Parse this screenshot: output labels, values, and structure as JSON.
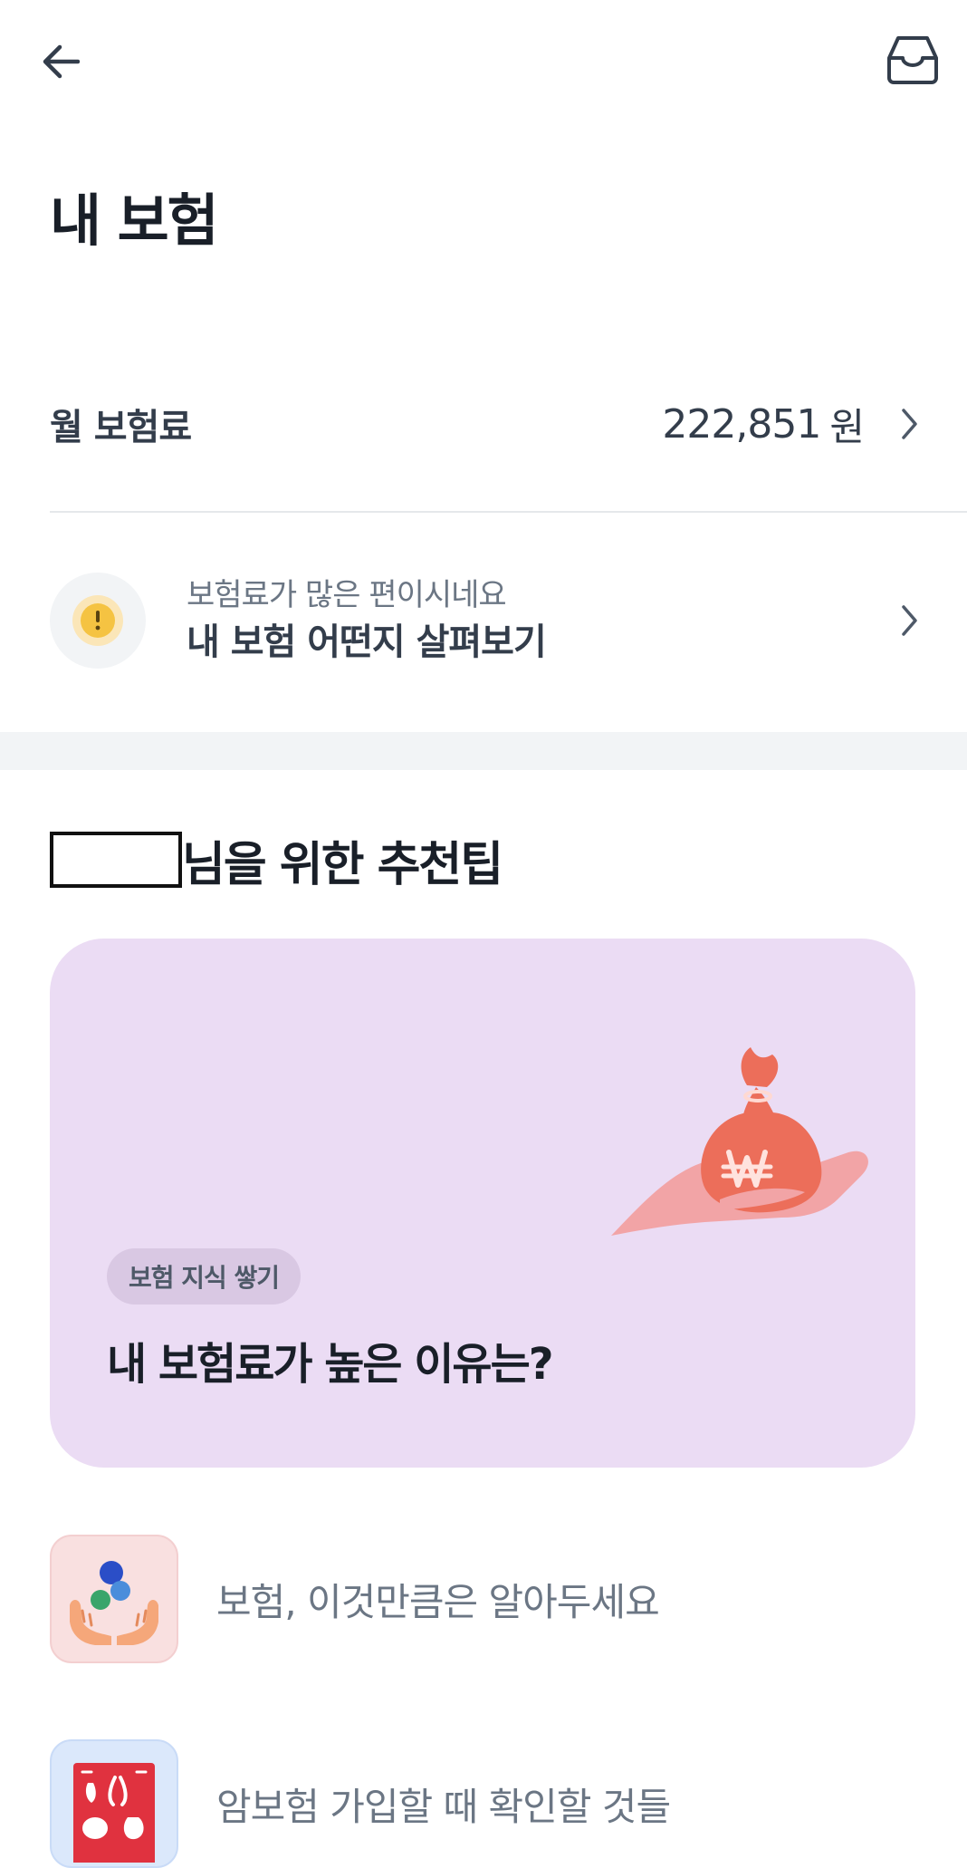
{
  "header": {
    "back_icon": "arrow-left-icon",
    "inbox_icon": "inbox-tray-icon"
  },
  "page": {
    "title": "내 보험"
  },
  "premium": {
    "label": "월 보험료",
    "amount": "222,851",
    "unit": "원"
  },
  "alert": {
    "icon": "exclamation-icon",
    "subtitle": "보험료가 많은 편이시네요",
    "title": "내 보험 어떤지 살펴보기"
  },
  "recommend": {
    "title_suffix": "님을 위한 추천팁",
    "card": {
      "illustration": "money-bag-hand-icon",
      "badge": "보험 지식 쌓기",
      "title": "내 보험료가 높은 이유는?",
      "background": "#ebdcf4"
    },
    "items": [
      {
        "label": "보험, 이것만큼은 알아두세요",
        "icon": "hands-balls-icon"
      },
      {
        "label": "암보험 가입할 때 확인할 것들",
        "icon": "organs-chart-icon"
      }
    ]
  },
  "colors": {
    "text_primary": "#191f28",
    "text_secondary": "#6b7684",
    "divider": "#e5e8eb",
    "section_gap": "#f2f4f6",
    "warning": "#f5c342"
  }
}
